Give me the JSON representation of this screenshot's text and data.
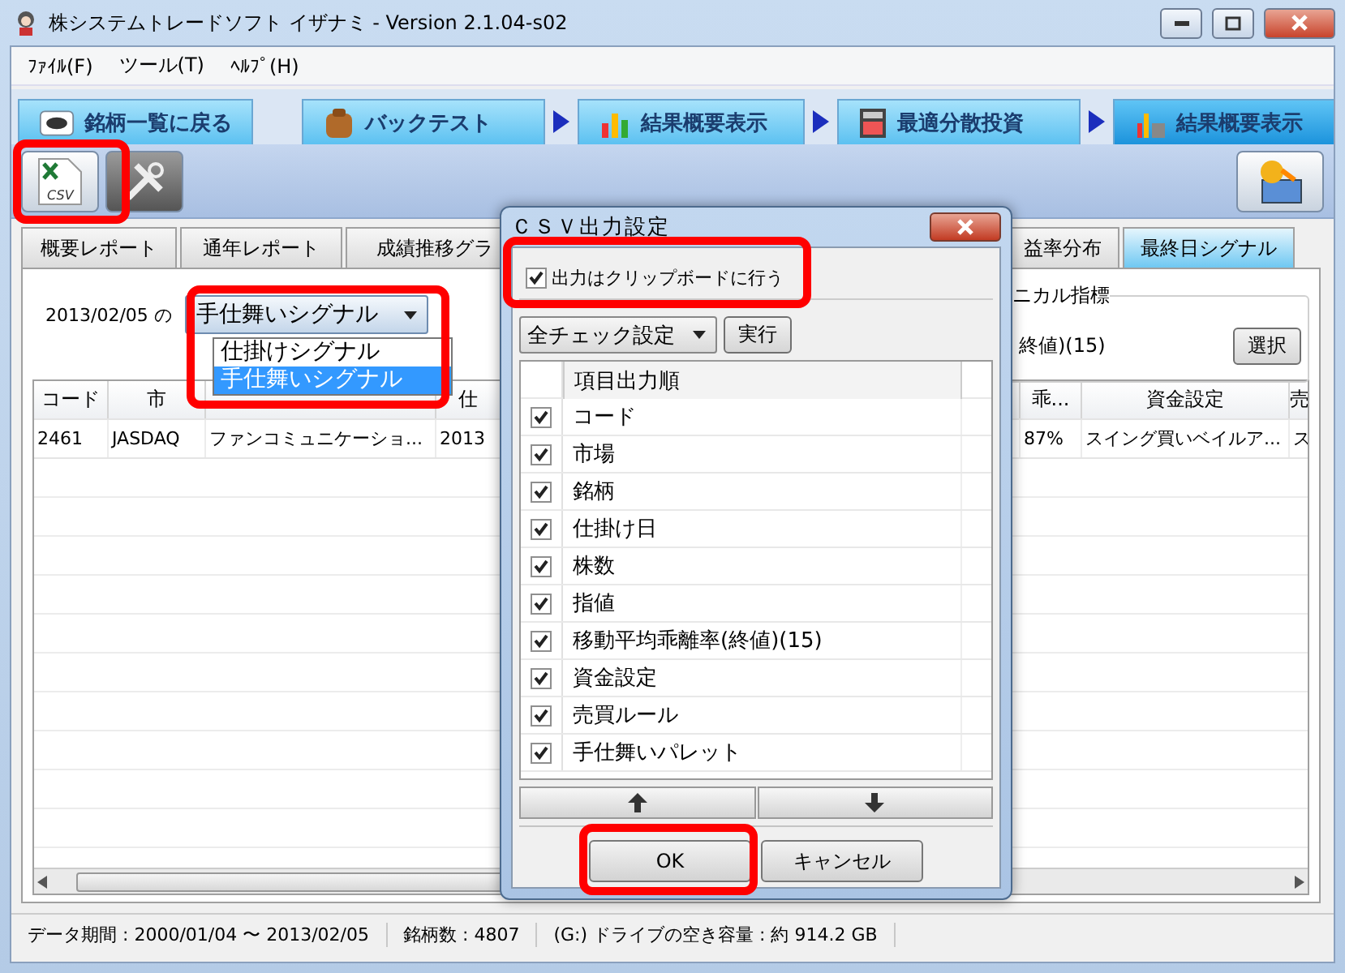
{
  "window": {
    "title": "株システムトレードソフト イザナミ - Version 2.1.04-s02"
  },
  "menu": [
    "ﾌｧｲﾙ(F)",
    "ツール(T)",
    "ﾍﾙﾌﾟ(H)"
  ],
  "nav_tabs": [
    {
      "label": "銘柄一覧に戻る",
      "selected": false
    },
    {
      "label": "バックテスト",
      "selected": false
    },
    {
      "label": "結果概要表示",
      "selected": false
    },
    {
      "label": "最適分散投資",
      "selected": false
    },
    {
      "label": "結果概要表示",
      "selected": true
    }
  ],
  "toolbar": {
    "csv_icon_text": "CSV"
  },
  "sub_tabs": [
    {
      "label": "概要レポート",
      "selected": false
    },
    {
      "label": "通年レポート",
      "selected": false
    },
    {
      "label": "成績推移グラ",
      "selected": false
    },
    {
      "label": "益率分布",
      "selected": false
    },
    {
      "label": "最終日シグナル",
      "selected": true
    }
  ],
  "signal_panel": {
    "date_label": "2013/02/05 の",
    "combo_value": "手仕舞いシグナル",
    "options": [
      {
        "label": "仕掛けシグナル",
        "selected": false
      },
      {
        "label": "手仕舞いシグナル",
        "selected": true
      }
    ],
    "indicator_group": {
      "title": "ニカル指標",
      "value": "終値)(15)",
      "button": "選択"
    }
  },
  "table": {
    "columns": [
      "コード",
      "市",
      "",
      "仕",
      "",
      "乖...",
      "資金設定",
      "売"
    ],
    "rows": [
      [
        "2461",
        "JASDAQ",
        "ファンコミュニケーショ...",
        "2013",
        "",
        "87%",
        "スイング買いベイルア...",
        "ス"
      ]
    ]
  },
  "dialog": {
    "title": "ＣＳＶ出力設定",
    "clipboard_label": "出力はクリップボードに行う",
    "clipboard_checked": true,
    "preset_value": "全チェック設定",
    "run_button": "実行",
    "list_header": "項目出力順",
    "items": [
      {
        "label": "コード",
        "checked": true
      },
      {
        "label": "市場",
        "checked": true
      },
      {
        "label": "銘柄",
        "checked": true
      },
      {
        "label": "仕掛け日",
        "checked": true
      },
      {
        "label": "株数",
        "checked": true
      },
      {
        "label": "指値",
        "checked": true
      },
      {
        "label": "移動平均乖離率(終値)(15)",
        "checked": true
      },
      {
        "label": "資金設定",
        "checked": true
      },
      {
        "label": "売買ルール",
        "checked": true
      },
      {
        "label": "手仕舞いパレット",
        "checked": true
      }
    ],
    "ok_button": "OK",
    "cancel_button": "キャンセル"
  },
  "status_bar": [
    "データ期間 : 2000/01/04 〜 2013/02/05",
    "銘柄数 : 4807",
    "(G:) ドライブの空き容量 : 約 914.2 GB"
  ]
}
